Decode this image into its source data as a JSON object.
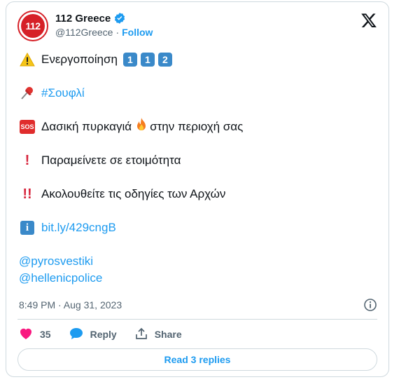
{
  "account": {
    "name": "112 Greece",
    "handle": "@112Greece",
    "separator": "·",
    "follow_label": "Follow",
    "avatar_text": "112"
  },
  "tweet": {
    "line1_text": "Ενεργοποίηση",
    "line1_keycaps": [
      "1",
      "1",
      "2"
    ],
    "line2_hashtag": "#Σουφλί",
    "line3_text_a": "Δασική πυρκαγιά",
    "line3_text_b": "στην περιοχή σας",
    "line4_text": "Παραμείνετε σε ετοιμότητα",
    "line5_text": "Ακολουθείτε τις οδηγίες των Αρχών",
    "line6_link": "bit.ly/429cngB",
    "mention1": "@pyrosvestiki",
    "mention2": "@hellenicpolice",
    "sos_label": "SOS",
    "info_label": "i"
  },
  "meta": {
    "timestamp": "8:49 PM · Aug 31, 2023"
  },
  "actions": {
    "likes_count": "35",
    "reply_label": "Reply",
    "share_label": "Share"
  },
  "footer": {
    "read_replies_label": "Read 3 replies"
  },
  "colors": {
    "accent": "#1d9bf0",
    "like": "#f91880",
    "brand_red": "#d62027"
  }
}
